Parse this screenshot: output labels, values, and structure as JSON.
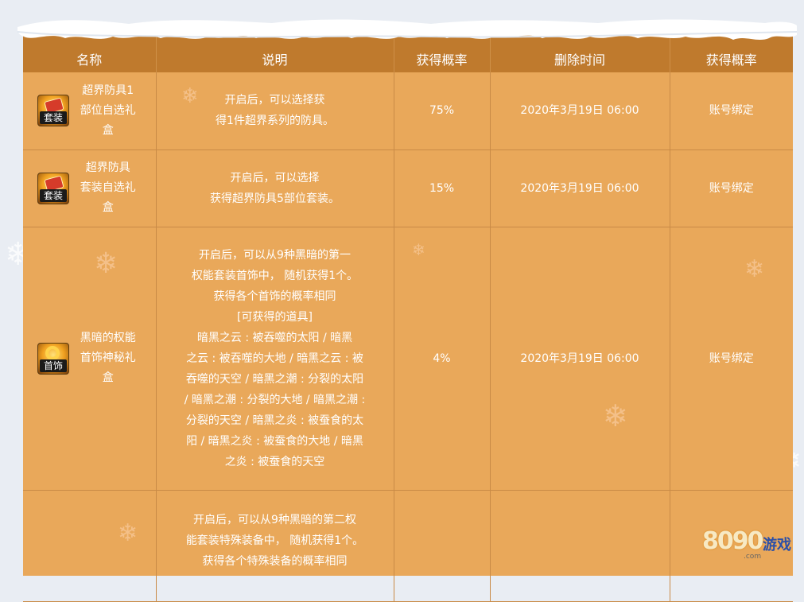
{
  "table": {
    "headers": [
      "名称",
      "说明",
      "获得概率",
      "删除时间",
      "获得概率"
    ],
    "rows": [
      {
        "icon": "armor-box-icon",
        "icon_tag": "套装",
        "name_lines": [
          "超界防具1",
          "部位自选礼盒"
        ],
        "desc_lines": [
          "开启后，可以选择获",
          "得1件超界系列的防具。"
        ],
        "rate": "75%",
        "delete_time": "2020年3月19日 06:00",
        "binding": "账号绑定"
      },
      {
        "icon": "armor-box-icon",
        "icon_tag": "套装",
        "name_lines": [
          "超界防具",
          "套装自选礼盒"
        ],
        "desc_lines": [
          "开启后，可以选择",
          "获得超界防具5部位套装。"
        ],
        "rate": "15%",
        "delete_time": "2020年3月19日 06:00",
        "binding": "账号绑定"
      },
      {
        "icon": "ring-box-icon",
        "icon_tag": "首饰",
        "name_lines": [
          "黑暗的权能",
          "首饰神秘礼盒"
        ],
        "desc_lines": [
          "开启后，可以从9种黑暗的第一",
          "权能套装首饰中， 随机获得1个。",
          "获得各个首饰的概率相同",
          "[可获得的道具]",
          "暗黑之云 : 被吞噬的太阳 / 暗黑",
          "之云 : 被吞噬的大地 / 暗黑之云 : 被",
          "吞噬的天空 / 暗黑之潮 : 分裂的太阳",
          "/ 暗黑之潮 : 分裂的大地 / 暗黑之潮 :",
          "分裂的天空 / 暗黑之炎 : 被蚕食的太",
          "阳 / 暗黑之炎 : 被蚕食的大地 / 暗黑",
          "之炎 : 被蚕食的天空"
        ],
        "rate": "4%",
        "delete_time": "2020年3月19日 06:00",
        "binding": "账号绑定"
      },
      {
        "icon": "",
        "icon_tag": "",
        "name_lines": [],
        "desc_lines": [
          "开启后，可以从9种黑暗的第二权",
          "能套装特殊装备中， 随机获得1个。",
          "获得各个特殊装备的概率相同"
        ],
        "rate": "",
        "delete_time": "",
        "binding": ""
      }
    ]
  },
  "watermark": {
    "digits": "8090",
    "word": "游戏",
    "domain": ".com"
  },
  "colors": {
    "header_bg": "#bf7a2d",
    "cell_bg": "#e9a85a",
    "grid_line": "#c98a46",
    "text": "#ffffff"
  }
}
